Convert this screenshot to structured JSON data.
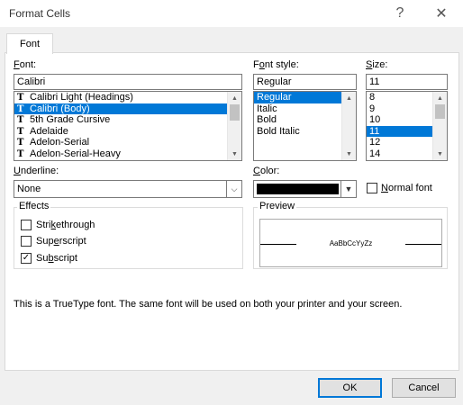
{
  "window": {
    "title": "Format Cells",
    "help_glyph": "?",
    "close_glyph": "✕"
  },
  "tabs": [
    {
      "label": "Font"
    }
  ],
  "font": {
    "label_accel": "F",
    "label_rest": "ont:",
    "value": "Calibri",
    "items": [
      {
        "label": "Calibri Light (Headings)",
        "selected": false
      },
      {
        "label": "Calibri (Body)",
        "selected": true
      },
      {
        "label": "5th Grade Cursive",
        "selected": false
      },
      {
        "label": "Adelaide",
        "selected": false
      },
      {
        "label": "Adelon-Serial",
        "selected": false
      },
      {
        "label": "Adelon-Serial-Heavy",
        "selected": false
      }
    ],
    "item_icon": "truetype-icon",
    "item_icon_glyph": "T"
  },
  "font_style": {
    "label_pre": "F",
    "label_accel": "o",
    "label_rest": "nt style:",
    "value": "Regular",
    "items": [
      {
        "label": "Regular",
        "selected": true
      },
      {
        "label": "Italic",
        "selected": false
      },
      {
        "label": "Bold",
        "selected": false
      },
      {
        "label": "Bold Italic",
        "selected": false
      }
    ]
  },
  "size": {
    "label_accel": "S",
    "label_rest": "ize:",
    "value": "11",
    "items": [
      {
        "label": "8",
        "selected": false
      },
      {
        "label": "9",
        "selected": false
      },
      {
        "label": "10",
        "selected": false
      },
      {
        "label": "11",
        "selected": true
      },
      {
        "label": "12",
        "selected": false
      },
      {
        "label": "14",
        "selected": false
      }
    ]
  },
  "underline": {
    "label_accel": "U",
    "label_rest": "nderline:",
    "value": "None"
  },
  "color": {
    "label_accel": "C",
    "label_rest": "olor:",
    "swatch": "#000000"
  },
  "normal_font": {
    "label_accel": "N",
    "label_rest": "ormal font",
    "checked": false
  },
  "effects": {
    "title": "Effects",
    "items": [
      {
        "pre": "Stri",
        "accel": "k",
        "rest": "ethrough",
        "checked": false
      },
      {
        "pre": "Sup",
        "accel": "e",
        "rest": "rscript",
        "checked": false
      },
      {
        "pre": "Su",
        "accel": "b",
        "rest": "script",
        "checked": true
      }
    ]
  },
  "preview": {
    "title": "Preview",
    "sample": "AaBbCcYyZz"
  },
  "info_text": "This is a TrueType font.  The same font will be used on both your printer and your screen.",
  "buttons": {
    "ok": "OK",
    "cancel": "Cancel"
  },
  "colors": {
    "selection": "#0078d7",
    "dialog_bg": "#f0f0f0"
  },
  "icons": {
    "dropdown": "chevron-down-icon",
    "scroll_up": "scroll-up-arrow-icon",
    "scroll_down": "scroll-down-arrow-icon",
    "check": "checkmark-icon"
  }
}
